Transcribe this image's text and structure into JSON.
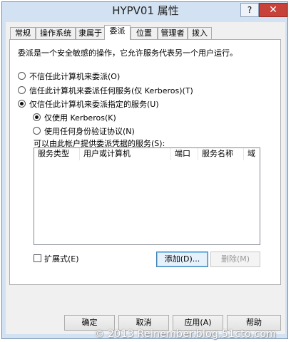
{
  "window": {
    "title": "HYPV01 属性",
    "help_glyph": "?",
    "close_glyph": "✕"
  },
  "tabs": [
    {
      "label": "常规"
    },
    {
      "label": "操作系统"
    },
    {
      "label": "隶属于"
    },
    {
      "label": "委派"
    },
    {
      "label": "位置"
    },
    {
      "label": "管理者"
    },
    {
      "label": "拨入"
    }
  ],
  "delegation": {
    "description": "委派是一个安全敏感的操作，它允许服务代表另一个用户运行。",
    "options": [
      {
        "label": "不信任此计算机来委派(O)",
        "selected": false
      },
      {
        "label": "信任此计算机来委派任何服务(仅 Kerberos)(T)",
        "selected": false
      },
      {
        "label": "仅信任此计算机来委派指定的服务(U)",
        "selected": true
      }
    ],
    "sub_options": [
      {
        "label": "仅使用 Kerberos(K)",
        "selected": true
      },
      {
        "label": "使用任何身份验证协议(N)",
        "selected": false
      }
    ],
    "services_label": "可以由此帐户提供委派凭据的服务(S):",
    "columns": [
      "服务类型",
      "用户或计算机",
      "端口",
      "服务名称",
      "域"
    ],
    "rows": [],
    "expanded_label": "扩展式(E)",
    "expanded_checked": false,
    "add_button": "添加(D)...",
    "remove_button": "删除(M)"
  },
  "footer": {
    "ok": "确定",
    "cancel": "取消",
    "apply": "应用(A)",
    "help": "帮助"
  },
  "watermark": "© 2013 Reinember.blog.51cto.com"
}
